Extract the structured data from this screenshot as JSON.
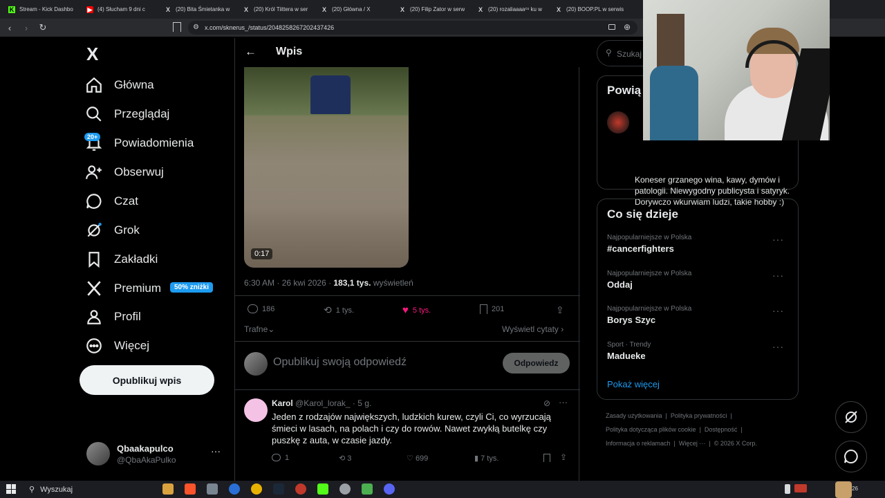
{
  "tabs": [
    {
      "label": "Stream - Kick Dashbo",
      "icon": "kick-icon"
    },
    {
      "label": "(4) Słucham 9 dni c",
      "icon": "youtube-icon"
    },
    {
      "label": "(20) Bita Śmietanka w",
      "icon": "x-icon"
    },
    {
      "label": "(20) Król Tiittera w ser",
      "icon": "x-icon"
    },
    {
      "label": "(20) Główna / X",
      "icon": "x-icon"
    },
    {
      "label": "(20) Filip Zator w serw",
      "icon": "x-icon"
    },
    {
      "label": "(20) rozaliaaaaᶜᵘ ku w",
      "icon": "x-icon"
    },
    {
      "label": "(20) BOOP.PL w serwis",
      "icon": "x-icon"
    }
  ],
  "browser": {
    "url": "x.com/sknerus_/status/2048258267202437426"
  },
  "nav": {
    "items": [
      {
        "label": "Główna",
        "icon": "home-icon"
      },
      {
        "label": "Przeglądaj",
        "icon": "search-icon"
      },
      {
        "label": "Powiadomienia",
        "icon": "bell-icon"
      },
      {
        "label": "Obserwuj",
        "icon": "follow-icon"
      },
      {
        "label": "Czat",
        "icon": "chat-icon"
      },
      {
        "label": "Grok",
        "icon": "grok-icon"
      },
      {
        "label": "Zakładki",
        "icon": "bookmark-icon"
      },
      {
        "label": "Premium",
        "icon": "x-logo-icon"
      },
      {
        "label": "Profil",
        "icon": "profile-icon"
      },
      {
        "label": "Więcej",
        "icon": "more-icon"
      }
    ],
    "notif_badge": "20+",
    "premium_badge": "50% zniżki",
    "post_button": "Opublikuj wpis",
    "account": {
      "name": "Qbaakapulco",
      "handle": "@QbaAkaPulko"
    }
  },
  "post": {
    "header_title": "Wpis",
    "video_duration": "0:17",
    "time": "6:30 AM",
    "date": "26 kwi 2026",
    "views_count": "183,1 tys.",
    "views_label": "wyświetleń",
    "replies": "186",
    "reposts": "1 tys.",
    "likes": "5 tys.",
    "bookmarks": "201",
    "sort_label": "Trafne",
    "quotes_link": "Wyświetl cytaty",
    "reply_placeholder": "Opublikuj swoją odpowiedź",
    "reply_button": "Odpowiedz",
    "like_color": "#f91880"
  },
  "reply": {
    "name": "Karol",
    "handle": "@Karol_lorak_",
    "time": "5 g.",
    "text": "Jeden z rodzajów największych, ludzkich kurew, czyli Ci, co wyrzucają śmieci w lasach, na polach i czy do rowów. Nawet zwykłą butelkę czy puszkę z auta, w czasie jazdy.",
    "replies": "1",
    "reposts": "3",
    "likes": "699",
    "views": "7 tys."
  },
  "right": {
    "search_placeholder": "Szukaj",
    "related_title": "Powią",
    "bio": "Koneser grzanego wina, kawy, dymów i patologii. Niewygodny publicysta i satyryk. Dorywczo wkurwiam ludzi, takie hobby :)",
    "trends_title": "Co się dzieje",
    "trends": [
      {
        "category": "Najpopularniejsze w Polska",
        "name": "#cancerfighters"
      },
      {
        "category": "Najpopularniejsze w Polska",
        "name": "Oddaj"
      },
      {
        "category": "Najpopularniejsze w Polska",
        "name": "Borys Szyc"
      },
      {
        "category": "Sport · Trendy",
        "name": "Madueke"
      }
    ],
    "show_more": "Pokaż więcej",
    "footer": {
      "terms": "Zasady użytkowania",
      "privacy": "Polityka prywatności",
      "cookies": "Polityka dotycząca plików cookie",
      "accessibility": "Dostępność",
      "ads": "Informacja o reklamach",
      "more": "Więcej ···",
      "copyright": "© 2026 X Corp."
    }
  },
  "taskbar": {
    "search": "Wyszukaj",
    "clock": "26"
  }
}
